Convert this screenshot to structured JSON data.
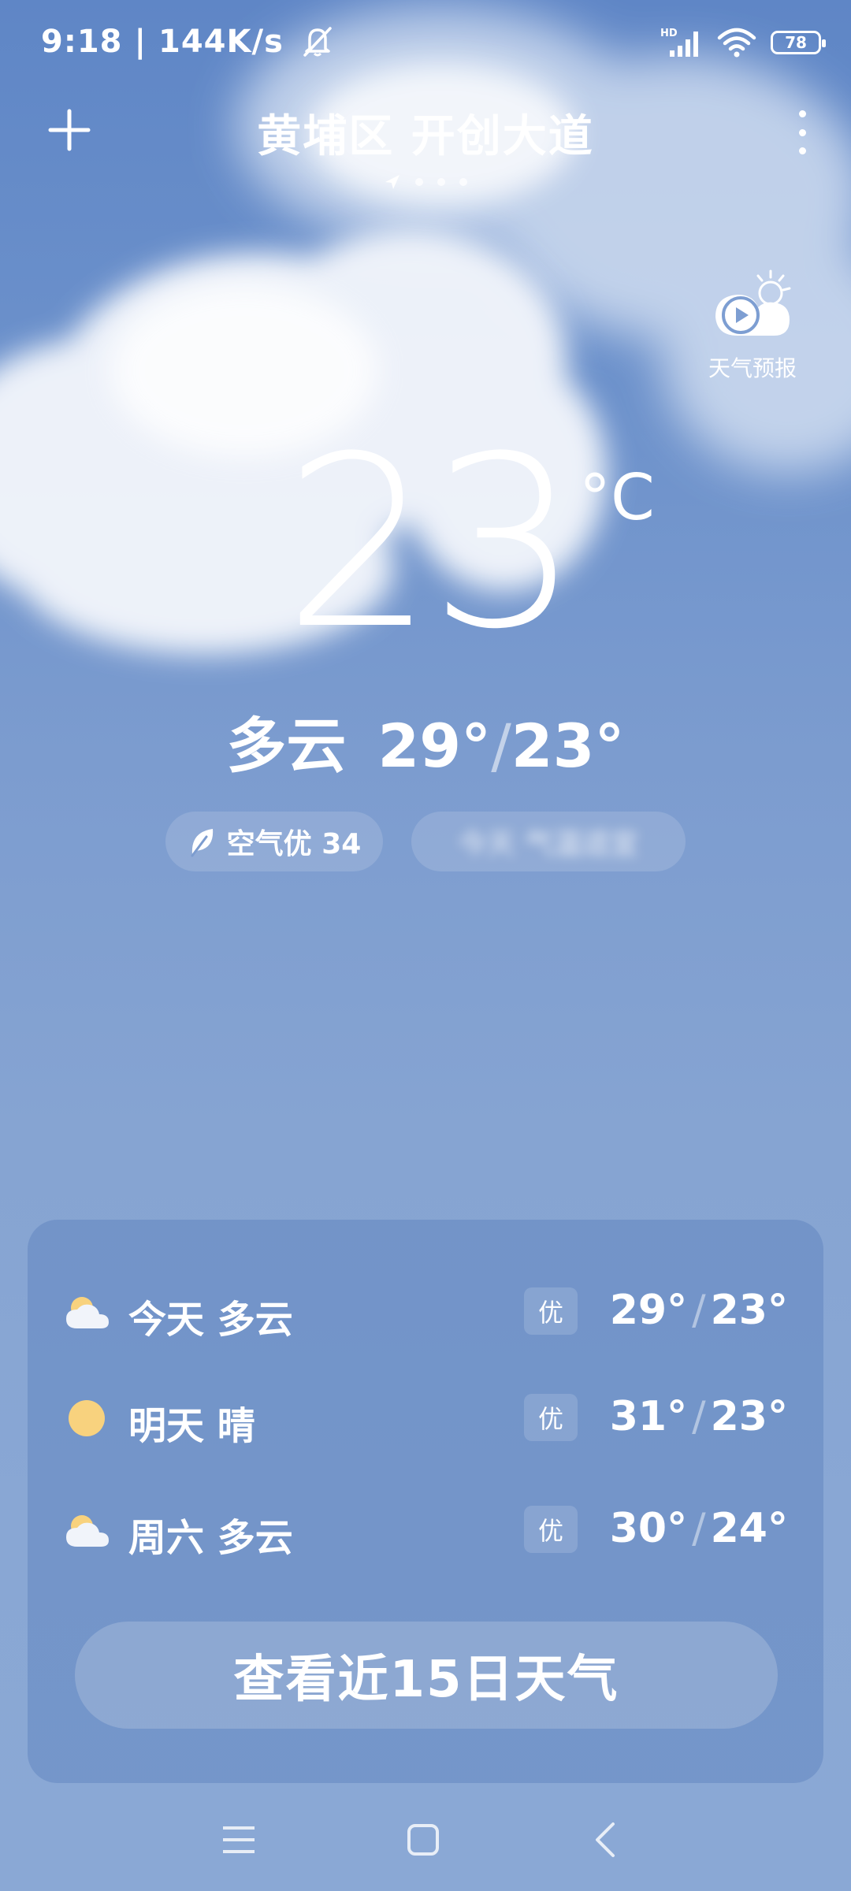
{
  "status_bar": {
    "time": "9:18",
    "speed": "144K/s",
    "network_label": "HD",
    "battery": "78",
    "icons": [
      "mute-bell-icon",
      "signal-icon",
      "wifi-icon",
      "battery-icon"
    ]
  },
  "header": {
    "location": "黄埔区 开创大道",
    "page_count": 4
  },
  "forecast_video": {
    "label": "天气预报",
    "icon": "play-cloud-sun-icon"
  },
  "current": {
    "temperature": "23",
    "unit": "°C",
    "condition": "多云",
    "high": "29°",
    "low": "23°",
    "separator": "/"
  },
  "aqi_pill": {
    "label": "空气优 34",
    "icon": "leaf-icon"
  },
  "blurred_pill": {
    "text": "今天 气温适宜"
  },
  "forecast": [
    {
      "day": "今天",
      "condition": "多云",
      "aqi": "优",
      "high": "29°",
      "low": "23°",
      "icon": "partly-cloudy-icon"
    },
    {
      "day": "明天",
      "condition": "晴",
      "aqi": "优",
      "high": "31°",
      "low": "23°",
      "icon": "sun-icon"
    },
    {
      "day": "周六",
      "condition": "多云",
      "aqi": "优",
      "high": "30°",
      "low": "24°",
      "icon": "partly-cloudy-icon"
    }
  ],
  "more_button": {
    "label": "查看近15日天气"
  },
  "nav_bar": {
    "icons": [
      "menu-icon",
      "home-icon",
      "back-icon"
    ]
  },
  "colors": {
    "sky_top": "#5f86c6",
    "sky_bottom": "#8aa8d5",
    "sun": "#f8d27e"
  }
}
